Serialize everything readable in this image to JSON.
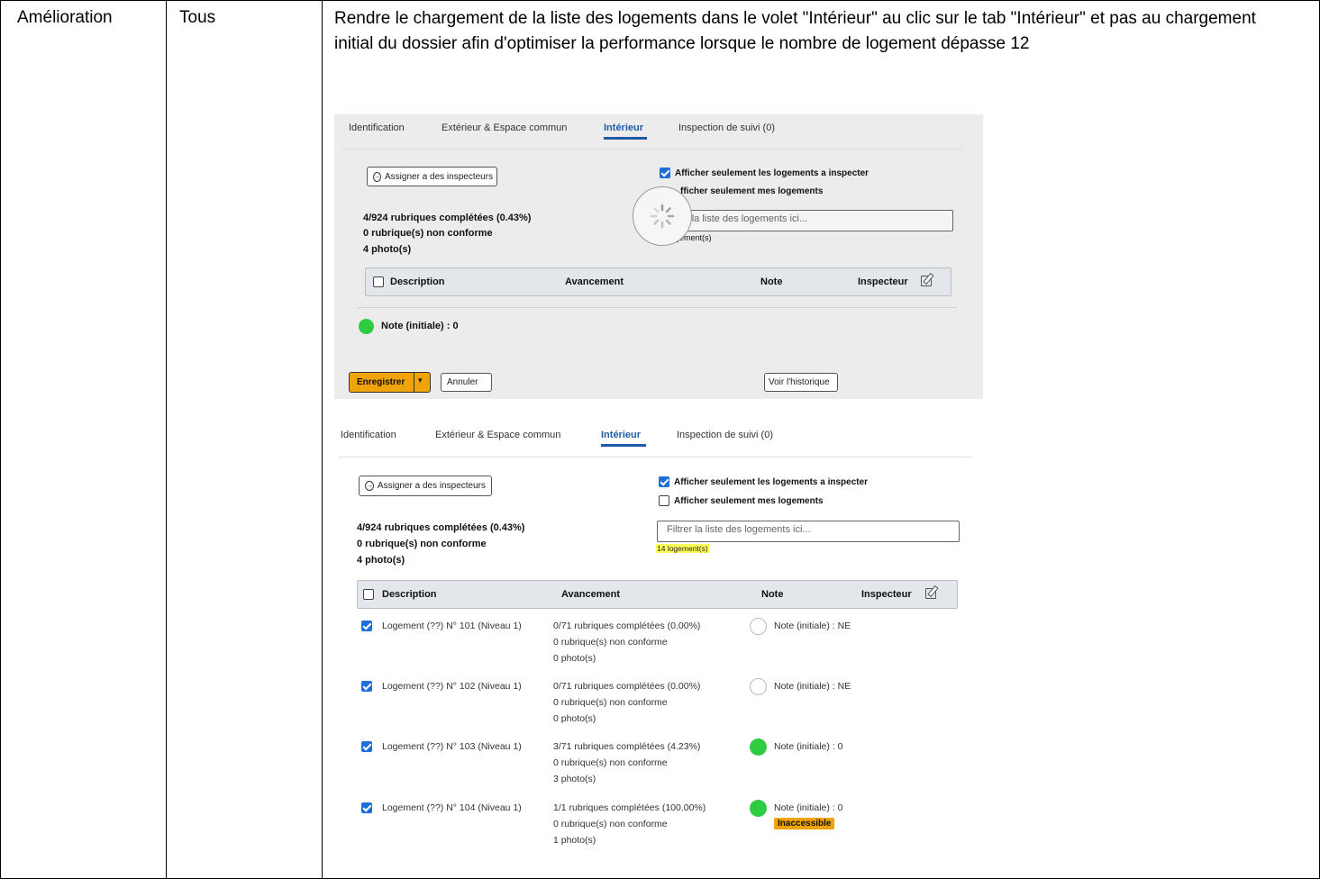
{
  "row": {
    "type": "Amélioration",
    "scope": "Tous",
    "description": "Rendre le chargement de la liste des logements dans le volet \"Intérieur\" au clic sur le tab \"Intérieur\" et pas au chargement initial du dossier afin d'optimiser la performance lorsque le nombre de logement dépasse 12"
  },
  "shot1": {
    "tabs": [
      "Identification",
      "Extérieur & Espace commun",
      "Intérieur",
      "Inspection de suivi (0)"
    ],
    "assign_button": "Assigner a des inspecteurs",
    "filter1": "Afficher seulement les logements a inspecter",
    "filter2": "fficher seulement mes logements",
    "stat1": "4/924 rubriques complétées (0.43%)",
    "stat2": "0 rubrique(s) non conforme",
    "stat3": "4 photo(s)",
    "search_placeholder": "r la liste des logements ici...",
    "count_text": "gement(s)",
    "headers": [
      "Description",
      "Avancement",
      "Note",
      "Inspecteur"
    ],
    "note_label": "Note (initiale) : 0",
    "save_button": "Enregistrer",
    "cancel_button": "Annuler",
    "history_button": "Voir l'historique"
  },
  "shot2": {
    "tabs": [
      "Identification",
      "Extérieur & Espace commun",
      "Intérieur",
      "Inspection de suivi (0)"
    ],
    "assign_button": "Assigner a des inspecteurs",
    "filter1": "Afficher seulement les logements a inspecter",
    "filter2": "Afficher seulement mes logements",
    "stat1": "4/924 rubriques complétées (0.43%)",
    "stat2": "0 rubrique(s) non conforme",
    "stat3": "4 photo(s)",
    "search_placeholder": "Filtrer la liste des logements ici...",
    "count_text": "14 logement(s)",
    "headers": [
      "Description",
      "Avancement",
      "Note",
      "Inspecteur"
    ],
    "rows": [
      {
        "name": "Logement (??) N° 101 (Niveau 1)",
        "progress": "0/71 rubriques complétées (0.00%)",
        "nonconf": "0 rubrique(s) non conforme",
        "photos": "0 photo(s)",
        "note": "Note (initiale) : NE"
      },
      {
        "name": "Logement (??) N° 102 (Niveau 1)",
        "progress": "0/71 rubriques complétées (0.00%)",
        "nonconf": "0 rubrique(s) non conforme",
        "photos": "0 photo(s)",
        "note": "Note (initiale) : NE"
      },
      {
        "name": "Logement (??) N° 103 (Niveau 1)",
        "progress": "3/71 rubriques complétées (4.23%)",
        "nonconf": "0 rubrique(s) non conforme",
        "photos": "3 photo(s)",
        "note": "Note (initiale) : 0"
      },
      {
        "name": "Logement (??) N° 104 (Niveau 1)",
        "progress": "1/1 rubriques complétées (100.00%)",
        "nonconf": "0 rubrique(s) non conforme",
        "photos": "1 photo(s)",
        "note": "Note (initiale) : 0",
        "badge": "Inaccessible"
      }
    ]
  },
  "colors": {
    "accent": "#1f5aa6",
    "status_ok": "#2ecc40",
    "warning": "#f0a30a",
    "highlight": "#ffff5c"
  }
}
